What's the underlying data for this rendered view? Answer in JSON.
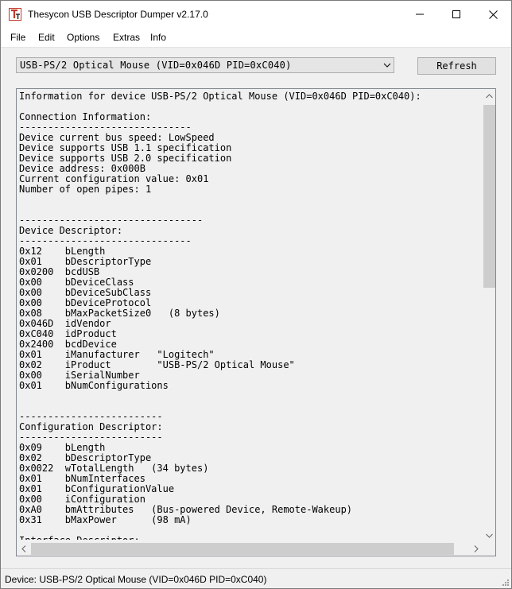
{
  "window": {
    "title": "Thesycon USB Descriptor Dumper v2.17.0"
  },
  "titlebar_buttons": {
    "minimize_icon": "minimize-icon",
    "maximize_icon": "maximize-icon",
    "close_icon": "close-icon"
  },
  "menu": [
    "File",
    "Edit",
    "Options",
    "Extras",
    "Info"
  ],
  "device_combo": {
    "selected": "USB-PS/2 Optical Mouse (VID=0x046D PID=0xC040)"
  },
  "refresh_label": "Refresh",
  "output_lines": [
    "Information for device USB-PS/2 Optical Mouse (VID=0x046D PID=0xC040):",
    "",
    "Connection Information:",
    "------------------------------",
    "Device current bus speed: LowSpeed",
    "Device supports USB 1.1 specification",
    "Device supports USB 2.0 specification",
    "Device address: 0x000B",
    "Current configuration value: 0x01",
    "Number of open pipes: 1",
    "",
    "",
    "--------------------------------",
    "Device Descriptor:",
    "------------------------------",
    "0x12    bLength",
    "0x01    bDescriptorType",
    "0x0200  bcdUSB",
    "0x00    bDeviceClass",
    "0x00    bDeviceSubClass",
    "0x00    bDeviceProtocol",
    "0x08    bMaxPacketSize0   (8 bytes)",
    "0x046D  idVendor",
    "0xC040  idProduct",
    "0x2400  bcdDevice",
    "0x01    iManufacturer   \"Logitech\"",
    "0x02    iProduct        \"USB-PS/2 Optical Mouse\"",
    "0x00    iSerialNumber",
    "0x01    bNumConfigurations",
    "",
    "",
    "-------------------------",
    "Configuration Descriptor:",
    "-------------------------",
    "0x09    bLength",
    "0x02    bDescriptorType",
    "0x0022  wTotalLength   (34 bytes)",
    "0x01    bNumInterfaces",
    "0x01    bConfigurationValue",
    "0x00    iConfiguration",
    "0xA0    bmAttributes   (Bus-powered Device, Remote-Wakeup)",
    "0x31    bMaxPower      (98 mA)",
    "",
    "Interface Descriptor:"
  ],
  "status": {
    "text": "Device: USB-PS/2 Optical Mouse (VID=0x046D PID=0xC040)"
  }
}
